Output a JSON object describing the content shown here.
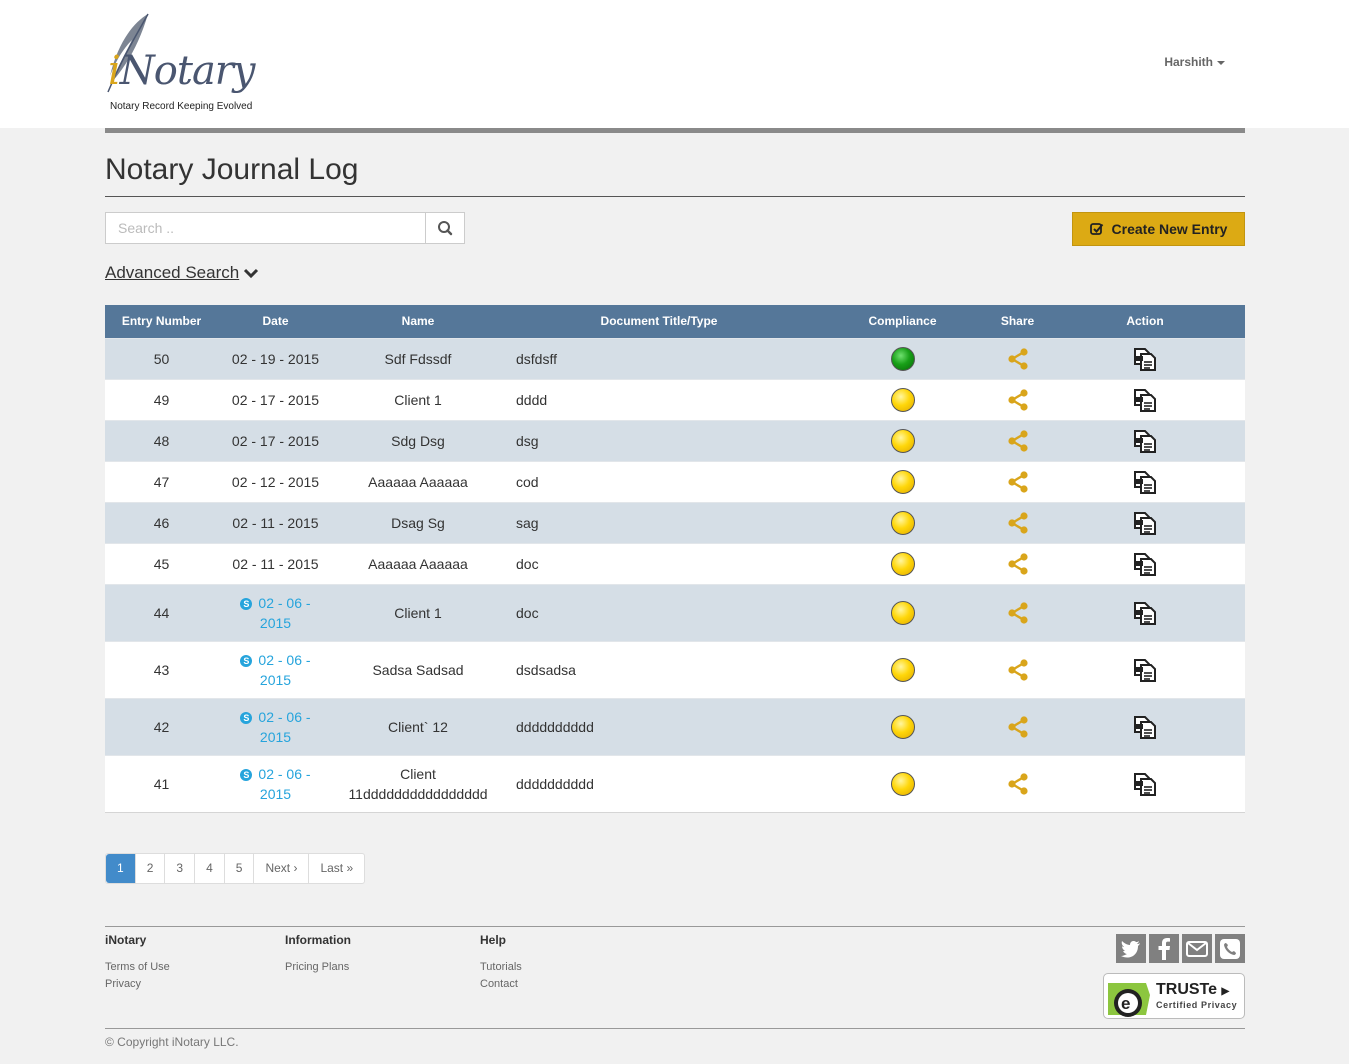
{
  "brand": {
    "logo_main": "Notary",
    "logo_i": "i",
    "tagline": "Notary Record Keeping Evolved"
  },
  "user": {
    "name": "Harshith"
  },
  "page": {
    "title": "Notary Journal Log"
  },
  "search": {
    "placeholder": "Search .."
  },
  "actions": {
    "create_label": "Create New Entry",
    "advanced_search_label": "Advanced Search"
  },
  "table": {
    "headers": {
      "entry": "Entry Number",
      "date": "Date",
      "name": "Name",
      "doc": "Document Title/Type",
      "compliance": "Compliance",
      "share": "Share",
      "action": "Action"
    },
    "rows": [
      {
        "entry": "50",
        "date": "02 - 19 - 2015",
        "name": "Sdf Fdssdf",
        "doc": "dsfdsff",
        "compliance": "green"
      },
      {
        "entry": "49",
        "date": "02 - 17 - 2015",
        "name": "Client 1",
        "doc": "dddd",
        "compliance": "yellow"
      },
      {
        "entry": "48",
        "date": "02 - 17 - 2015",
        "name": "Sdg Dsg",
        "doc": "dsg",
        "compliance": "yellow"
      },
      {
        "entry": "47",
        "date": "02 - 12 - 2015",
        "name": "Aaaaaa Aaaaaa",
        "doc": "cod",
        "compliance": "yellow"
      },
      {
        "entry": "46",
        "date": "02 - 11 - 2015",
        "name": "Dsag Sg",
        "doc": "sag",
        "compliance": "yellow"
      },
      {
        "entry": "45",
        "date": "02 - 11 - 2015",
        "name": "Aaaaaa Aaaaaa",
        "doc": "doc",
        "compliance": "yellow"
      },
      {
        "entry": "44",
        "date_l1": "02 - 06 -",
        "date_l2": "2015",
        "skype": true,
        "name": "Client 1",
        "doc": "doc",
        "compliance": "yellow"
      },
      {
        "entry": "43",
        "date_l1": "02 - 06 -",
        "date_l2": "2015",
        "skype": true,
        "name": "Sadsa Sadsad",
        "doc": "dsdsadsa",
        "compliance": "yellow"
      },
      {
        "entry": "42",
        "date_l1": "02 - 06 -",
        "date_l2": "2015",
        "skype": true,
        "name": "Client` 12",
        "doc": "dddddddddd",
        "compliance": "yellow"
      },
      {
        "entry": "41",
        "date_l1": "02 - 06 -",
        "date_l2": "2015",
        "skype": true,
        "name_l1": "Client",
        "name_l2": "11dddddddddddddddd",
        "doc": "dddddddddd",
        "compliance": "yellow"
      }
    ]
  },
  "pagination": {
    "pages": [
      "1",
      "2",
      "3",
      "4",
      "5"
    ],
    "next": "Next ›",
    "last": "Last »",
    "active": "1"
  },
  "footer": {
    "col1": {
      "title": "iNotary",
      "links": [
        "Terms of Use",
        "Privacy"
      ]
    },
    "col2": {
      "title": "Information",
      "links": [
        "Pricing Plans"
      ]
    },
    "col3": {
      "title": "Help",
      "links": [
        "Tutorials",
        "Contact"
      ]
    },
    "social": [
      "twitter-icon",
      "facebook-icon",
      "email-icon",
      "phone-icon"
    ],
    "truste_title": "TRUSTe",
    "truste_sub": "Certified Privacy",
    "copyright": "© Copyright iNotary LLC."
  },
  "colors": {
    "accent": "#dcaa14",
    "header_bg": "#557799",
    "row_alt": "#d5dee6",
    "share_icon": "#d9a51b",
    "skype": "#26a4dc",
    "pagination_active": "#428bca"
  }
}
